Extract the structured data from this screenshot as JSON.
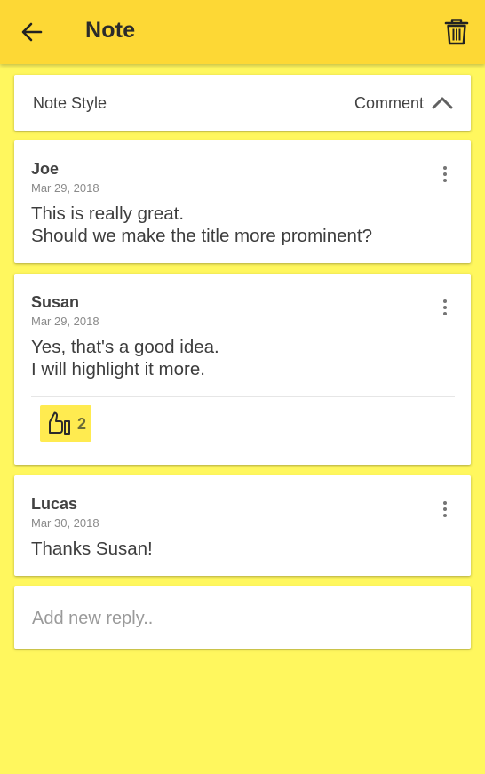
{
  "app_bar": {
    "title": "Note",
    "back_icon": "arrow-left-icon",
    "delete_icon": "trash-icon"
  },
  "note_style": {
    "label": "Note Style",
    "value": "Comment",
    "expand_icon": "chevron-up-icon"
  },
  "comments": [
    {
      "author": "Joe",
      "date": "Mar 29, 2018",
      "lines": [
        "This is really great.",
        "Should we make the title more prominent?"
      ]
    },
    {
      "author": "Susan",
      "date": "Mar 29, 2018",
      "lines": [
        "Yes, that's a good idea.",
        "I will highlight it more."
      ],
      "likes": "2"
    },
    {
      "author": "Lucas",
      "date": "Mar 30, 2018",
      "lines": [
        "Thanks Susan!"
      ]
    }
  ],
  "reply": {
    "placeholder": "Add new reply.."
  },
  "colors": {
    "app_bar": "#fdd835",
    "background": "#fff75e",
    "like_chip": "#ffeb50"
  }
}
